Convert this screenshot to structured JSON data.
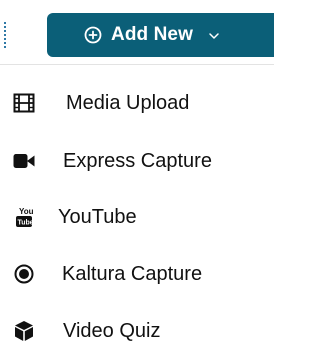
{
  "toolbar": {
    "add_new_label": "Add New",
    "add_new_icon": "plus-circle-icon",
    "dropdown_icon": "chevron-down-icon",
    "button_color": "#0b5f78"
  },
  "menu": {
    "items": [
      {
        "label": "Media Upload",
        "icon": "film-icon"
      },
      {
        "label": "Express Capture",
        "icon": "video-camera-icon"
      },
      {
        "label": "YouTube",
        "icon": "youtube-icon"
      },
      {
        "label": "Kaltura Capture",
        "icon": "record-icon"
      },
      {
        "label": "Video Quiz",
        "icon": "cube-icon"
      }
    ]
  }
}
